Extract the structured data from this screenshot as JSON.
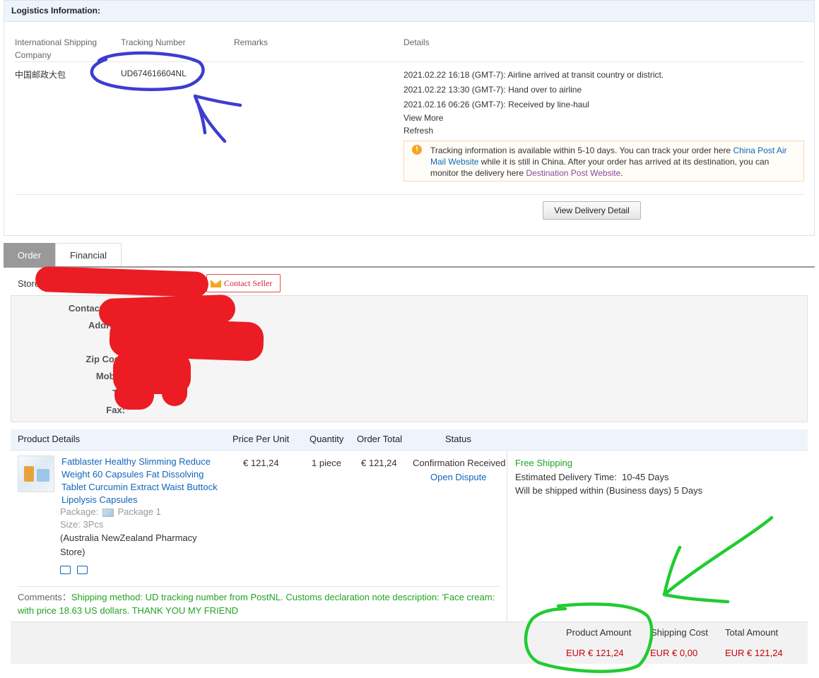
{
  "logistics": {
    "title": "Logistics Information:",
    "headers": {
      "company": "International Shipping Company",
      "tracking": "Tracking Number",
      "remarks": "Remarks",
      "details": "Details"
    },
    "company": "中国邮政大包",
    "tracking_number": "UD674616604NL",
    "events": [
      "2021.02.22 16:18 (GMT-7): Airline arrived at transit country or district.",
      "2021.02.22 13:30 (GMT-7): Hand over to airline",
      "2021.02.16 06:26 (GMT-7): Received by line-haul"
    ],
    "view_more": "View More",
    "refresh": "Refresh",
    "notice": {
      "part1": "Tracking information is available within 5-10 days. You can track your order here ",
      "link1": "China Post Air Mail Website",
      "part2": " while it is still in China. After your order has arrived at its destination, you can monitor the delivery here ",
      "link2": "Destination Post Website",
      "part3": "."
    },
    "view_delivery_btn": "View Delivery Detail"
  },
  "tabs": {
    "order": "Order",
    "financial": "Financial"
  },
  "store": {
    "label": "Store",
    "contact_seller": "Contact Seller"
  },
  "contact": {
    "contact_name_label": "Contact Nam",
    "address_label": "Address",
    "zip_label": "Zip Code",
    "mobile_label": "Mobile",
    "tel_label": "Tel",
    "fax_label": "Fax:"
  },
  "product_table": {
    "headers": {
      "details": "Product Details",
      "price": "Price Per Unit",
      "quantity": "Quantity",
      "order_total": "Order Total",
      "status": "Status"
    },
    "item": {
      "name": "Fatblaster Healthy Slimming Reduce Weight 60 Capsules Fat Dissolving Tablet Curcumin Extract Waist Buttock Lipolysis Capsules",
      "package_label": "Package:",
      "package_value": "Package 1",
      "size": "Size: 3Pcs",
      "shop": "(Australia NewZealand Pharmacy Store)",
      "price": "€ 121,24",
      "quantity": "1 piece",
      "order_total": "€ 121,24",
      "status": "Confirmation Received",
      "open_dispute": "Open Dispute"
    },
    "shipping": {
      "free": "Free Shipping",
      "delivery_label": "Estimated Delivery Time:",
      "delivery_value": "10-45 Days",
      "ship_within": "Will be shipped within (Business days) 5 Days"
    },
    "comments_label": "Comments：",
    "comments_text": "Shipping method: UD tracking number from PostNL. Customs declaration note description: 'Face cream: with price 18.63 US dollars. THANK YOU MY FRIEND"
  },
  "totals": {
    "product_amount_label": "Product Amount",
    "shipping_cost_label": "Shipping Cost",
    "total_amount_label": "Total Amount",
    "product_amount": "EUR € 121,24",
    "shipping_cost": "EUR € 0,00",
    "total_amount": "EUR € 121,24"
  },
  "colors": {
    "link": "#1166bb",
    "price_red": "#c7000b",
    "green_text": "#22a322",
    "annotation_blue": "#3d3dd0",
    "annotation_green": "#20cc30",
    "redaction_red": "#ec1c24"
  }
}
